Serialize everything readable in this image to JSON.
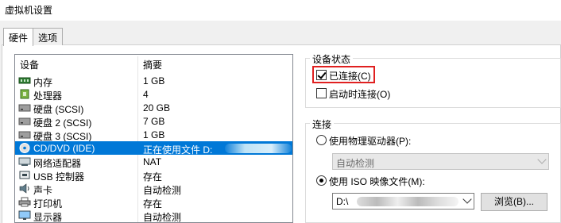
{
  "window": {
    "title": "虚拟机设置"
  },
  "tabs": [
    {
      "label": "硬件",
      "active": true
    },
    {
      "label": "选项",
      "active": false
    }
  ],
  "device_list": {
    "columns": [
      "设备",
      "摘要"
    ],
    "rows": [
      {
        "name": "内存",
        "summary": "1 GB",
        "icon": "memory-icon"
      },
      {
        "name": "处理器",
        "summary": "4",
        "icon": "cpu-icon"
      },
      {
        "name": "硬盘 (SCSI)",
        "summary": "20 GB",
        "icon": "harddisk-icon"
      },
      {
        "name": "硬盘 2 (SCSI)",
        "summary": "7 GB",
        "icon": "harddisk-icon"
      },
      {
        "name": "硬盘 3 (SCSI)",
        "summary": "1 GB",
        "icon": "harddisk-icon"
      },
      {
        "name": "CD/DVD (IDE)",
        "summary": "正在使用文件 D:",
        "icon": "cd-dvd-icon",
        "selected": true
      },
      {
        "name": "网络适配器",
        "summary": "NAT",
        "icon": "network-adapter-icon"
      },
      {
        "name": "USB 控制器",
        "summary": "存在",
        "icon": "usb-icon"
      },
      {
        "name": "声卡",
        "summary": "自动检测",
        "icon": "sound-card-icon"
      },
      {
        "name": "打印机",
        "summary": "存在",
        "icon": "printer-icon"
      },
      {
        "name": "显示器",
        "summary": "自动检测",
        "icon": "display-icon"
      }
    ]
  },
  "device_status": {
    "group_label": "设备状态",
    "connected_label": "已连接(C)",
    "connected_checked": true,
    "connect_at_power_on_label": "启动时连接(O)",
    "connect_at_power_on_checked": false
  },
  "connection": {
    "group_label": "连接",
    "physical_drive_label": "使用物理驱动器(P):",
    "physical_drive_selected": false,
    "physical_drive_value": "自动检测",
    "iso_label": "使用 ISO 映像文件(M):",
    "iso_selected": true,
    "iso_path": "D:\\",
    "browse_label": "浏览(B)..."
  },
  "colors": {
    "selection": "#0078d7",
    "highlight": "#e02020"
  }
}
